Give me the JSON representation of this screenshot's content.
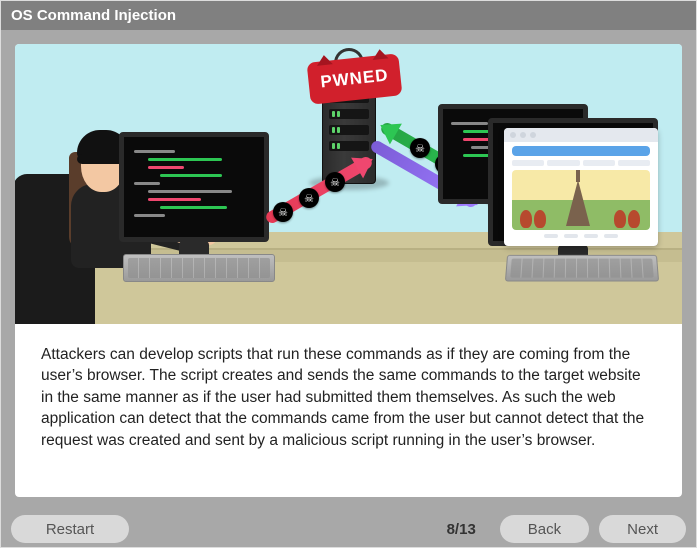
{
  "header": {
    "title": "OS Command Injection"
  },
  "scene": {
    "pwned_label": "PWNED",
    "icons": {
      "skull": "skull-crossbones-icon",
      "server": "server-icon",
      "hacker": "hacker-avatar",
      "monitor": "code-monitor",
      "browser": "browser-window"
    }
  },
  "body": {
    "text": "Attackers can develop scripts that run these commands as if they are coming from the user’s browser. The script creates and sends the same commands to the target website in the same manner as if the user had submitted them themselves. As such the web application can detect that the commands came from the user but cannot detect that the request was created and sent by a malicious script running in the user’s browser."
  },
  "footer": {
    "restart_label": "Restart",
    "back_label": "Back",
    "next_label": "Next",
    "page_current": 8,
    "page_total": 13,
    "page_display": "8/13"
  }
}
